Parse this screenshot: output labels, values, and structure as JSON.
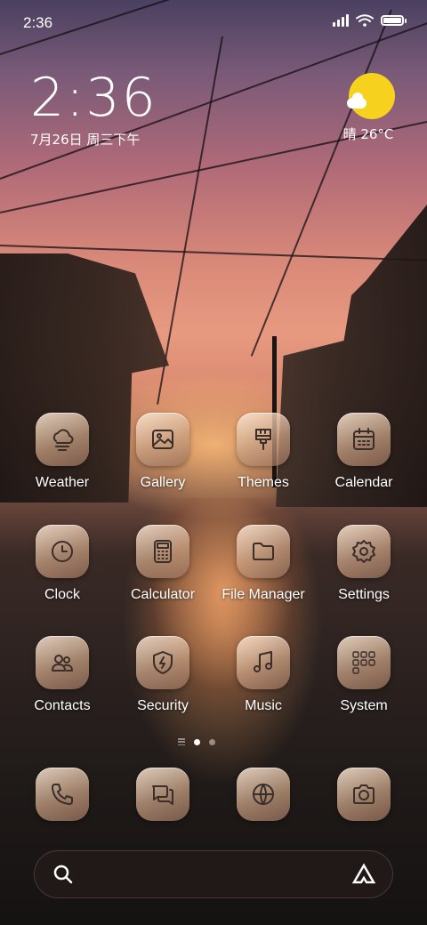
{
  "status_bar": {
    "time": "2:36",
    "icons": [
      "signal-icon",
      "wifi-icon",
      "battery-icon"
    ]
  },
  "clock_widget": {
    "time": "2:36",
    "date": "7月26日 周三下午"
  },
  "weather_widget": {
    "condition_icon": "sun-cloud-icon",
    "text": "晴 26°C"
  },
  "apps": [
    {
      "label": "Weather",
      "icon": "weather-icon"
    },
    {
      "label": "Gallery",
      "icon": "gallery-icon"
    },
    {
      "label": "Themes",
      "icon": "themes-icon"
    },
    {
      "label": "Calendar",
      "icon": "calendar-icon"
    },
    {
      "label": "Clock",
      "icon": "clock-icon"
    },
    {
      "label": "Calculator",
      "icon": "calculator-icon"
    },
    {
      "label": "File Manager",
      "icon": "folder-icon"
    },
    {
      "label": "Settings",
      "icon": "gear-icon"
    },
    {
      "label": "Contacts",
      "icon": "contacts-icon"
    },
    {
      "label": "Security",
      "icon": "shield-icon"
    },
    {
      "label": "Music",
      "icon": "music-icon"
    },
    {
      "label": "System",
      "icon": "folder-grid-icon"
    }
  ],
  "page_indicator": {
    "pages": 2,
    "active": 1
  },
  "dock": [
    {
      "icon": "phone-icon"
    },
    {
      "icon": "message-icon"
    },
    {
      "icon": "browser-icon"
    },
    {
      "icon": "camera-icon"
    }
  ],
  "search_bar": {
    "left_icon": "search-icon",
    "right_icon": "assistant-icon"
  },
  "colors": {
    "icon_bg": "#c8a082",
    "sun": "#f6d21f",
    "glyph": "#3a2e2a"
  }
}
